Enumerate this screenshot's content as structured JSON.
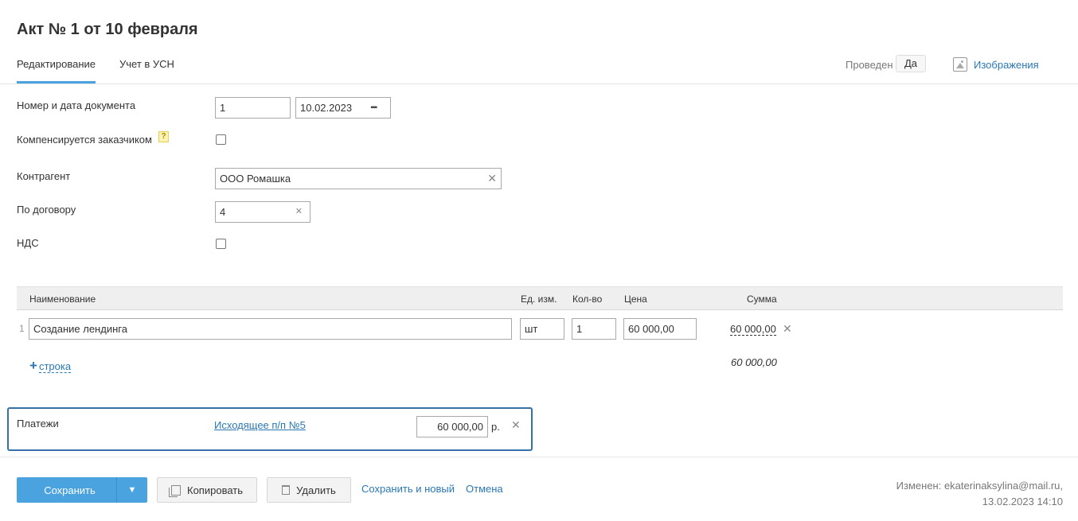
{
  "page": {
    "title": "Акт № 1 от 10 февраля"
  },
  "tabs": [
    {
      "label": "Редактирование"
    },
    {
      "label": "Учет в УСН"
    }
  ],
  "status": {
    "posted_label": "Проведен",
    "posted_value": "Да",
    "images_label": "Изображения"
  },
  "form": {
    "doc_number_label": "Номер и дата документа",
    "doc_number": "1",
    "doc_date": "10.02.2023",
    "compensated_label": "Компенсируется заказчиком",
    "help_mark": "?",
    "counterparty_label": "Контрагент",
    "counterparty": "ООО Ромашка",
    "contract_label": "По договору",
    "contract": "4",
    "vat_label": "НДС"
  },
  "items_table": {
    "columns": {
      "name": "Наименование",
      "unit": "Ед. изм.",
      "qty": "Кол-во",
      "price": "Цена",
      "sum": "Сумма"
    },
    "rows": [
      {
        "num": "1",
        "name": "Создание лендинга",
        "unit": "шт",
        "qty": "1",
        "price": "60 000,00",
        "sum": "60 000,00"
      }
    ],
    "add_row_label": "строка",
    "total": "60 000,00"
  },
  "payments": {
    "label": "Платежи",
    "doc_link": "Исходящее п/п №5",
    "amount": "60 000,00",
    "currency": "р."
  },
  "footer": {
    "save_label": "Сохранить",
    "copy_label": "Копировать",
    "delete_label": "Удалить",
    "save_new_label": "Сохранить и новый",
    "cancel_label": "Отмена",
    "changed_line1": "Изменен: ekaterinaksylina@mail.ru,",
    "changed_line2": "13.02.2023 14:10"
  },
  "colors": {
    "accent": "#4aa3df",
    "link": "#2a77b4",
    "highlight_border": "#3570a8"
  }
}
